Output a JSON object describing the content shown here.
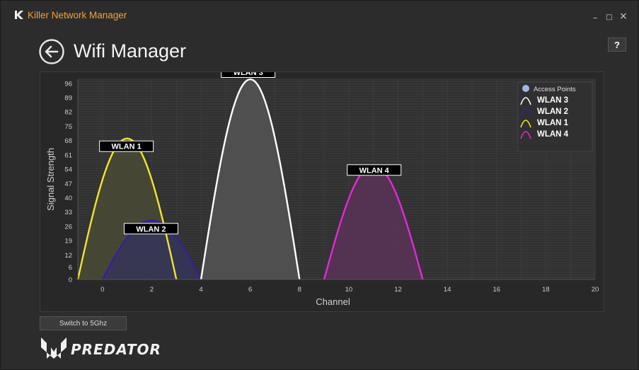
{
  "window": {
    "title": "Killer Network Manager",
    "minimize": "–",
    "maximize": "□",
    "close": "×"
  },
  "header": {
    "title": "Wifi Manager",
    "help_label": "?"
  },
  "footer": {
    "switch_label": "Switch to 5Ghz",
    "brand": "PREDATOR"
  },
  "colors": {
    "accent": "#f0a33a",
    "background": "#2c2c2c",
    "wlan1": "#f2e52a",
    "wlan2": "#3a1d9a",
    "wlan3": "#ffffff",
    "wlan4": "#e12ad8"
  },
  "chart_data": {
    "type": "area",
    "xlabel": "Channel",
    "ylabel": "Signal Strength",
    "xlim": [
      -1,
      20
    ],
    "ylim": [
      0,
      98
    ],
    "x_ticks": [
      0,
      2,
      4,
      6,
      8,
      10,
      12,
      14,
      16,
      18,
      20
    ],
    "y_ticks": [
      0,
      6,
      12,
      19,
      26,
      33,
      40,
      47,
      54,
      61,
      68,
      75,
      82,
      89,
      96
    ],
    "grid": true,
    "legend_position": "top-right",
    "legend_title": "Access Points",
    "legend_order": [
      "WLAN 3",
      "WLAN 2",
      "WLAN 1",
      "WLAN 4"
    ],
    "series": [
      {
        "name": "WLAN 1",
        "center": 1,
        "start": -1,
        "end": 3,
        "peak": 69,
        "color": "#f2e52a"
      },
      {
        "name": "WLAN 2",
        "center": 2,
        "start": 0,
        "end": 4,
        "peak": 29,
        "color": "#3a1d9a"
      },
      {
        "name": "WLAN 3",
        "center": 6,
        "start": 4,
        "end": 8,
        "peak": 98,
        "color": "#ffffff"
      },
      {
        "name": "WLAN 4",
        "center": 11,
        "start": 9,
        "end": 13,
        "peak": 56,
        "color": "#e12ad8"
      }
    ]
  }
}
